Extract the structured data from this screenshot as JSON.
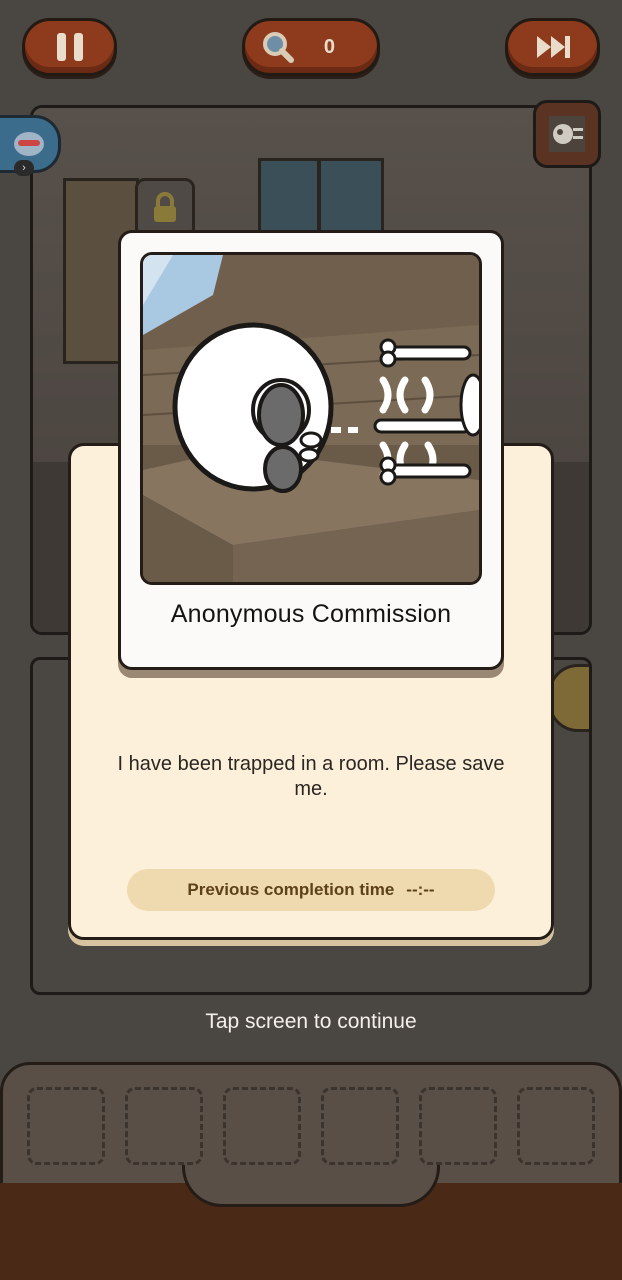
{
  "hud": {
    "pause_icon": "pause-icon",
    "hint_icon": "magnifier-icon",
    "hint_count": "0",
    "skip_icon": "fast-forward-icon"
  },
  "commission": {
    "title": "Anonymous Commission",
    "description": "I have been trapped in a room. Please save me.",
    "completion_label": "Previous completion time",
    "completion_value": "--:--"
  },
  "tap_hint": "Tap screen to continue",
  "inventory": {
    "slot_count": 6
  },
  "colors": {
    "button_brown": "#8e3a1c",
    "card_cream": "#fcf0da",
    "pill_tan": "#efd9ae",
    "tray_brown": "#4a2a17"
  }
}
